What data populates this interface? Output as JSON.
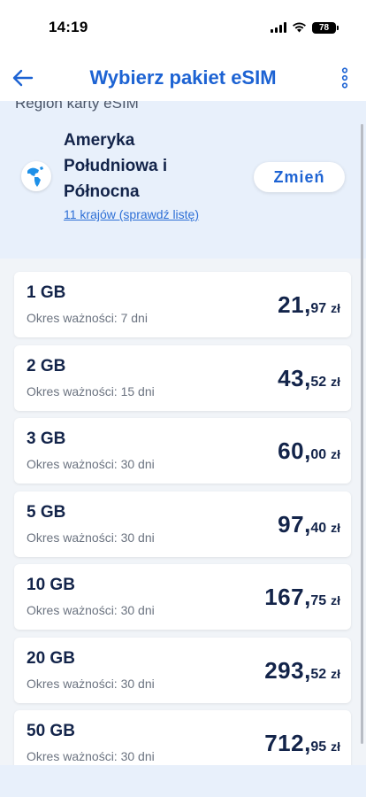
{
  "status_bar": {
    "time": "14:19",
    "battery": "78"
  },
  "nav": {
    "title": "Wybierz pakiet eSIM",
    "back_icon": "arrow-left-icon",
    "more_icon": "more-vertical-icon"
  },
  "region": {
    "caption": "Region karty eSIM",
    "name_lines": [
      "Ameryka",
      "Południowa i",
      "Północna"
    ],
    "countries_link": "11 krajów (sprawdź listę)",
    "change_label": "Zmień"
  },
  "packages": [
    {
      "size": "1 GB",
      "validity": "Okres ważności: 7 dni",
      "price_int": "21",
      "price_dec": "97",
      "currency": "zł"
    },
    {
      "size": "2 GB",
      "validity": "Okres ważności: 15 dni",
      "price_int": "43",
      "price_dec": "52",
      "currency": "zł"
    },
    {
      "size": "3 GB",
      "validity": "Okres ważności: 30 dni",
      "price_int": "60",
      "price_dec": "00",
      "currency": "zł"
    },
    {
      "size": "5 GB",
      "validity": "Okres ważności: 30 dni",
      "price_int": "97",
      "price_dec": "40",
      "currency": "zł"
    },
    {
      "size": "10 GB",
      "validity": "Okres ważności: 30 dni",
      "price_int": "167",
      "price_dec": "75",
      "currency": "zł"
    },
    {
      "size": "20 GB",
      "validity": "Okres ważności: 30 dni",
      "price_int": "293",
      "price_dec": "52",
      "currency": "zł"
    },
    {
      "size": "50 GB",
      "validity": "Okres ważności: 30 dni",
      "price_int": "712",
      "price_dec": "95",
      "currency": "zł"
    }
  ],
  "colors": {
    "accent": "#1d63d3",
    "text_dark": "#13244a",
    "panel_bg": "#e8f0fb",
    "list_bg": "#f1f4f8"
  }
}
